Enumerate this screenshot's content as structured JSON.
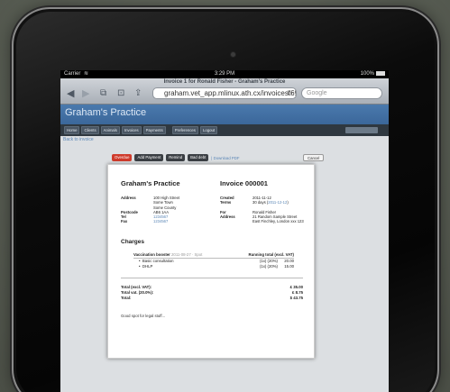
{
  "status_bar": {
    "carrier": "Carrier",
    "wifi_icon": "wifi-icon",
    "time": "3:29 PM",
    "battery": "100%"
  },
  "browser": {
    "page_title": "Invoice 1 for Ronald Fisher - Graham's Practice",
    "url": "graham.vet_app.mlinux.ath.cx/invoices/69",
    "search_placeholder": "Google",
    "icons": [
      "back-icon",
      "forward-icon",
      "tabs-icon",
      "bookmarks-icon",
      "share-icon",
      "reload-icon"
    ]
  },
  "app": {
    "brand": "Graham's Practice",
    "nav": [
      "Home",
      "Clients",
      "Animals",
      "Invoices",
      "Payments",
      "Preferences",
      "Logout"
    ]
  },
  "back_link": "Back to invoice",
  "actions": {
    "overdue": "Overdue",
    "add_payment": "Add Payment",
    "remind": "Remind",
    "bad_debt": "Bad debt",
    "download": "| Download PDF",
    "cancel": "Cancel"
  },
  "invoice": {
    "practice_name": "Graham's Practice",
    "invoice_title": "Invoice 000001",
    "practice": {
      "address_label": "Address",
      "address_lines": [
        "100 High Street",
        "Some Town",
        "Some County"
      ],
      "postcode_label": "Postcode",
      "postcode": "AB6 1AA",
      "tel_label": "Tel",
      "tel": "1234567",
      "fax_label": "Fax",
      "fax": "1234567"
    },
    "meta": {
      "created_label": "Created",
      "created": "2011-11-12",
      "terms_label": "Terms",
      "terms_prefix": "30 days (",
      "terms_date": "2011-12-12",
      "terms_suffix": ")",
      "for_label": "For",
      "client": "Ronald Fisher",
      "client_address_label": "Address",
      "client_address_lines": [
        "21 Random Sample Street",
        "East Finchley, London xxx 123"
      ]
    },
    "charges_heading": "Charges",
    "charges": {
      "item": "Vaccination booster",
      "item_meta": "2011-08-27 · Spot",
      "running_total_label": "Running total (excl. VAT)",
      "lines": [
        {
          "name": "Basic consultation",
          "vat": "(1x) (20%)",
          "amount": "20.00"
        },
        {
          "name": "DHLP",
          "vat": "(1x) (20%)",
          "amount": "15.00"
        }
      ]
    },
    "totals": [
      {
        "label": "Total (excl. VAT):",
        "value": "£ 35.00"
      },
      {
        "label": "Total vat. (20.0%):",
        "value": "£ 8.75"
      },
      {
        "label": "Total:",
        "value": "$ 43.75"
      }
    ],
    "legal": "Good spot for legal stuff..."
  },
  "colors": {
    "brand_blue": "#3f6da0",
    "nav_dark": "#2f3840",
    "overdue_red": "#cf3b2c",
    "link_blue": "#5a86b6"
  }
}
